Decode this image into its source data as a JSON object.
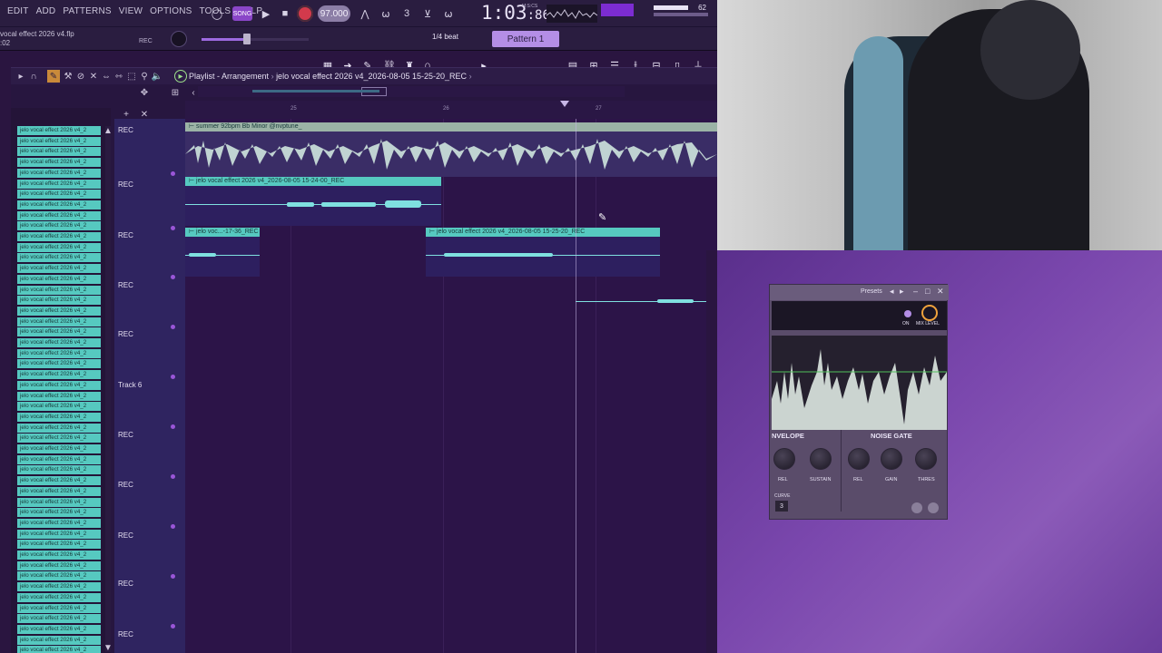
{
  "menu": [
    "EDIT",
    "ADD",
    "PATTERNS",
    "VIEW",
    "OPTIONS",
    "TOOLS",
    "HELP"
  ],
  "transport": {
    "pattern_chip": "SONG",
    "tempo": "97.000",
    "time_main": "1:03",
    "time_sub": "86",
    "time_unit": "M:S:CS",
    "meter_value": "62"
  },
  "project": {
    "filename": "vocal effect 2026 v4.flp",
    "position": ":02",
    "rec_label": "REC",
    "snap": "1/4 beat",
    "pattern": "Pattern 1"
  },
  "playlist": {
    "title": "Playlist - Arrangement",
    "clip_path": "jelo vocal effect 2026 v4_2026-08-05 15-25-20_REC",
    "ruler": [
      "25",
      "26",
      "27"
    ]
  },
  "browser_item": "jelo vocal effect 2026 v4_2",
  "tracks": [
    {
      "label": "REC"
    },
    {
      "label": "REC"
    },
    {
      "label": "REC"
    },
    {
      "label": "REC"
    },
    {
      "label": "REC"
    },
    {
      "label": "Track 6"
    },
    {
      "label": "REC"
    },
    {
      "label": "REC"
    },
    {
      "label": "REC"
    },
    {
      "label": "REC"
    },
    {
      "label": "REC"
    }
  ],
  "clips": {
    "beat": "summer 92bpm Bb Minor @nvptune_",
    "vocal1": "jelo vocal effect 2026 v4_2026-08-05 15-24-00_REC",
    "vocal2a": "jelo voc...-17-36_REC",
    "vocal2b": "jelo vocal effect 2026 v4_2026-08-05 15-25-20_REC"
  },
  "plugin": {
    "presets": "Presets",
    "on_label": "ON",
    "mix_label": "MIX LEVEL",
    "envelope": "NVELOPE",
    "noise_gate": "NOISE GATE",
    "knobs": [
      "REL",
      "SUSTAIN",
      "REL",
      "GAIN",
      "THRES"
    ],
    "curve_label": "CURVE",
    "curve_value": "3"
  },
  "colors": {
    "accent": "#9a56d8",
    "clip": "#56c9c0",
    "record": "#d23a4c"
  }
}
